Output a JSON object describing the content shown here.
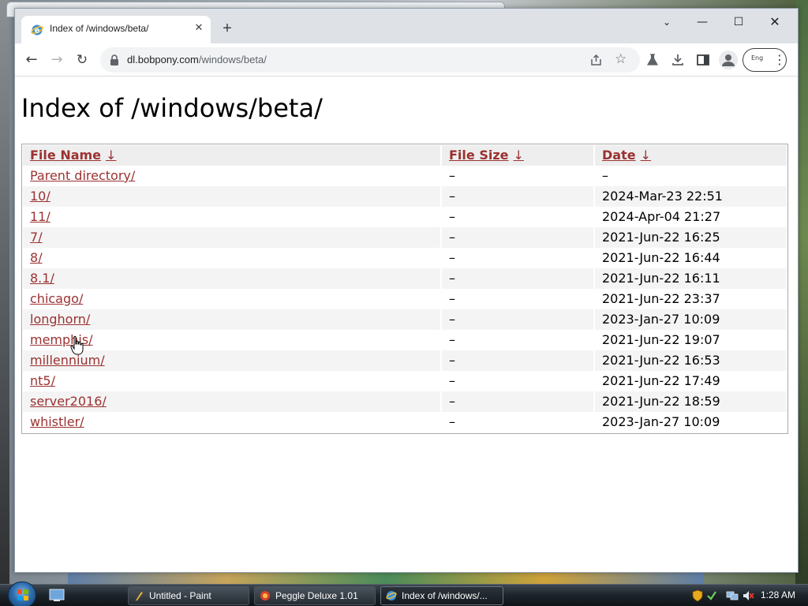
{
  "browser": {
    "tab": {
      "title": "Index of /windows/beta/",
      "close_glyph": "✕"
    },
    "new_tab_glyph": "+",
    "window_controls": {
      "chevron": "⌄",
      "minimize": "—",
      "maximize": "☐",
      "close": "✕"
    },
    "nav": {
      "back": "←",
      "forward": "→",
      "reload": "↻"
    },
    "url": {
      "host": "dl.bobpony.com",
      "path": "/windows/beta/"
    },
    "star_glyph": "☆",
    "extension_pill_label": "Eng",
    "menu_glyph": "⋮"
  },
  "page": {
    "title": "Index of /windows/beta/",
    "columns": [
      {
        "label": "File Name",
        "sort_arrow": "↓"
      },
      {
        "label": "File Size",
        "sort_arrow": "↓"
      },
      {
        "label": "Date",
        "sort_arrow": "↓"
      }
    ],
    "rows": [
      {
        "name": "Parent directory",
        "slash": "/",
        "size": "–",
        "date": "–"
      },
      {
        "name": "10",
        "slash": "/",
        "size": "–",
        "date": "2024-Mar-23 22:51"
      },
      {
        "name": "11",
        "slash": "/",
        "size": "–",
        "date": "2024-Apr-04 21:27"
      },
      {
        "name": "7",
        "slash": "/",
        "size": "–",
        "date": "2021-Jun-22 16:25"
      },
      {
        "name": "8",
        "slash": "/",
        "size": "–",
        "date": "2021-Jun-22 16:44"
      },
      {
        "name": "8.1",
        "slash": "/",
        "size": "–",
        "date": "2021-Jun-22 16:11"
      },
      {
        "name": "chicago",
        "slash": "/",
        "size": "–",
        "date": "2021-Jun-22 23:37"
      },
      {
        "name": "longhorn",
        "slash": "/",
        "size": "–",
        "date": "2023-Jan-27 10:09"
      },
      {
        "name": "memphis",
        "slash": "/",
        "size": "–",
        "date": "2021-Jun-22 19:07"
      },
      {
        "name": "millennium",
        "slash": "/",
        "size": "–",
        "date": "2021-Jun-22 16:53"
      },
      {
        "name": "nt5",
        "slash": "/",
        "size": "–",
        "date": "2021-Jun-22 17:49"
      },
      {
        "name": "server2016",
        "slash": "/",
        "size": "–",
        "date": "2021-Jun-22 18:59"
      },
      {
        "name": "whistler",
        "slash": "/",
        "size": "–",
        "date": "2023-Jan-27 10:09"
      }
    ]
  },
  "taskbar": {
    "tasks": [
      {
        "label": "Untitled - Paint",
        "icon": "paint-icon"
      },
      {
        "label": "Peggle Deluxe 1.01",
        "icon": "peggle-icon"
      },
      {
        "label": "Index of /windows/...",
        "icon": "browser-icon"
      }
    ],
    "clock": "1:28 AM"
  },
  "colors": {
    "link": "#9b3131",
    "header_bg": "#eeeeee",
    "alt_row_bg": "#f4f4f4"
  }
}
